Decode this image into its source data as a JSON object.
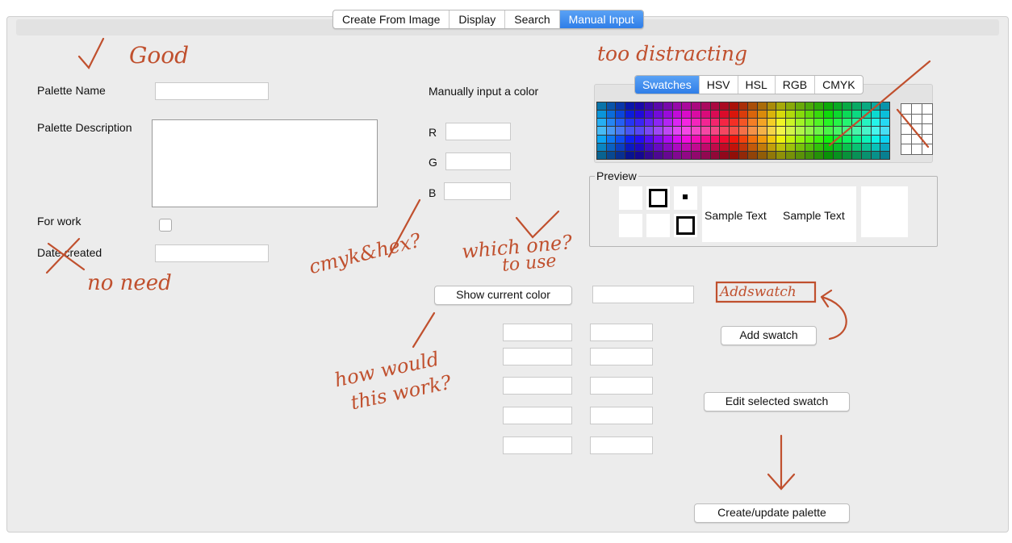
{
  "tabs": [
    "Create From Image",
    "Display",
    "Search",
    "Manual Input"
  ],
  "active_tab": "Manual Input",
  "form": {
    "palette_name_label": "Palette Name",
    "palette_name_value": "",
    "palette_description_label": "Palette Description",
    "palette_description_value": "",
    "for_work_label": "For work",
    "for_work_checked": false,
    "date_created_label": "Date created",
    "date_created_value": ""
  },
  "manual_color": {
    "heading": "Manually input a color",
    "r_label": "R",
    "g_label": "G",
    "b_label": "B",
    "r_value": "",
    "g_value": "",
    "b_value": ""
  },
  "color_chooser": {
    "tabs": [
      "Swatches",
      "HSV",
      "HSL",
      "RGB",
      "CMYK"
    ],
    "active_tab": "Swatches"
  },
  "preview": {
    "title": "Preview",
    "sample_text": "Sample Text"
  },
  "buttons": {
    "show_current_color": "Show current color",
    "add_swatch": "Add swatch",
    "edit_selected_swatch": "Edit selected swatch",
    "create_update_palette": "Create/update palette"
  },
  "annotations": {
    "good": "Good",
    "no_need": "no need",
    "too_distracting": "too distracting",
    "cmyk_hex": "cmyk&hex?",
    "which_one": "which one?",
    "to_use": "to use",
    "how_would": "how would",
    "this_work": "this work?",
    "addswatch": "Addswatch"
  },
  "colors": {
    "accent": "#2f7ee8",
    "annotation_ink": "#c0502e",
    "panel_bg": "#ececec"
  }
}
